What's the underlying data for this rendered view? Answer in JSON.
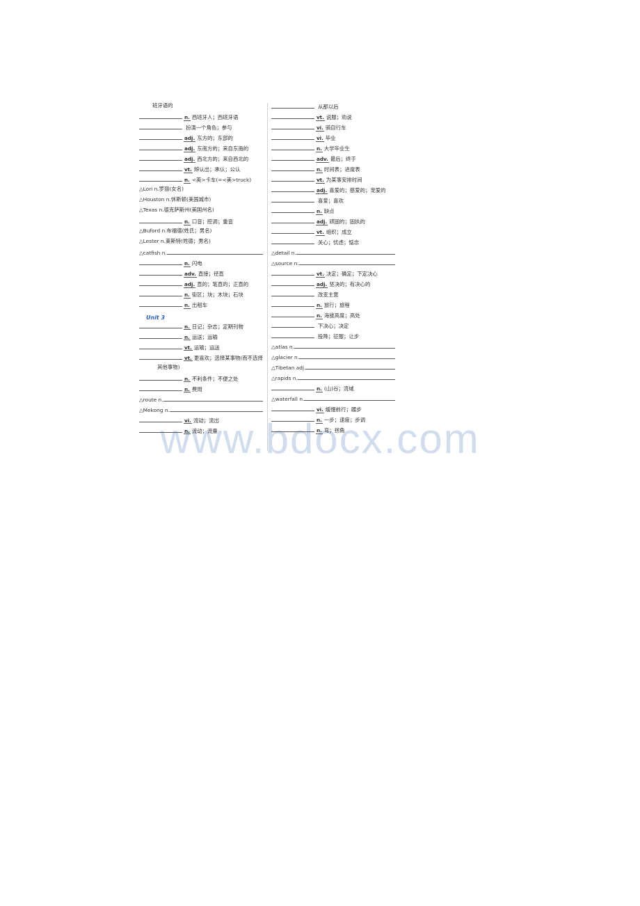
{
  "document": {
    "watermark": "www.bdocx.com",
    "accent_color": "#2f5fb0",
    "text_color": "#2f2f2f",
    "rule_color": "#555555"
  },
  "left_column": {
    "entries": [
      {
        "lead": "",
        "rule": "none",
        "pos": "",
        "cn": "班牙语的",
        "indent": "plain"
      },
      {
        "lead": "",
        "rule": "fixed",
        "pos": "n.",
        "cn": "西班牙人；西班牙语"
      },
      {
        "lead": "",
        "rule": "fixed",
        "pos": "",
        "cn": "扮演一个角色；参与"
      },
      {
        "lead": "",
        "rule": "fixed",
        "pos": "adj.",
        "cn": "东方的；东部的"
      },
      {
        "lead": "",
        "rule": "fixed",
        "pos": "adj.",
        "cn": "东南方的；来自东南的"
      },
      {
        "lead": "",
        "rule": "fixed",
        "pos": "adj.",
        "cn": "西北方的；来自西北的"
      },
      {
        "lead": "",
        "rule": "fixed",
        "pos": "vt.",
        "cn": "辨认出；承认；公认"
      },
      {
        "lead": "",
        "rule": "fixed",
        "pos": "n.",
        "cn": "<英>卡车(=<美>truck)"
      },
      {
        "lead": "△Lori n.罗丽(女名)",
        "rule": "none",
        "pos": "",
        "cn": "",
        "indent": "tri"
      },
      {
        "lead": "△Houston n.休斯顿(美国城市)",
        "rule": "none",
        "pos": "",
        "cn": "",
        "indent": "tri"
      },
      {
        "lead": "△Texas n.德克萨斯州(美国州名)",
        "rule": "none",
        "pos": "",
        "cn": "",
        "indent": "tri"
      },
      {
        "lead": "",
        "rule": "fixed",
        "pos": "n.",
        "cn": "口音；腔调；重音"
      },
      {
        "lead": "△Buford n.布福德(姓氏；男名)",
        "rule": "none",
        "pos": "",
        "cn": "",
        "indent": "tri"
      },
      {
        "lead": "△Lester n.莱斯特(姓德；男名)",
        "rule": "none",
        "pos": "",
        "cn": "",
        "indent": "tri"
      },
      {
        "lead": "△catfish n.",
        "rule": "trail",
        "pos": "",
        "cn": "",
        "indent": "tri"
      },
      {
        "lead": "",
        "rule": "fixed",
        "pos": "n.",
        "cn": "闪电"
      },
      {
        "lead": "",
        "rule": "fixed",
        "pos": "adv.",
        "cn": "直接；径直"
      },
      {
        "lead": "",
        "rule": "fixed",
        "pos": "adj.",
        "cn": "直的；笔直的；正直的"
      },
      {
        "lead": "",
        "rule": "fixed",
        "pos": "n.",
        "cn": "街区；块；木块；石块"
      },
      {
        "lead": "",
        "rule": "fixed",
        "pos": "n.",
        "cn": "出租车"
      }
    ],
    "unit_heading": "Unit 3",
    "entries_after_unit": [
      {
        "lead": "",
        "rule": "fixed",
        "pos": "n.",
        "cn": "日记；杂志；定期刊物"
      },
      {
        "lead": "",
        "rule": "fixed",
        "pos": "n.",
        "cn": "运送；运输"
      },
      {
        "lead": "",
        "rule": "fixed",
        "pos": "vt.",
        "cn": "运输；运送"
      },
      {
        "lead": "",
        "rule": "fixed",
        "pos": "vt.",
        "cn": "更喜欢；选择某事物(而不选择"
      },
      {
        "lead": "其他事物)",
        "rule": "none",
        "pos": "",
        "cn": "",
        "indent": "cont"
      },
      {
        "lead": "",
        "rule": "fixed",
        "pos": "n.",
        "cn": "不利条件；不便之处"
      },
      {
        "lead": "",
        "rule": "fixed",
        "pos": "n.",
        "cn": "费用"
      },
      {
        "lead": "△route n.",
        "rule": "trail",
        "pos": "",
        "cn": "",
        "indent": "tri"
      },
      {
        "lead": "△Mekong n.",
        "rule": "trail",
        "pos": "",
        "cn": "",
        "indent": "tri"
      },
      {
        "lead": "",
        "rule": "fixed",
        "pos": "vi.",
        "cn": "流动；流出"
      },
      {
        "lead": "",
        "rule": "fixed",
        "pos": "n.",
        "cn": "流动；流量"
      }
    ]
  },
  "right_column": {
    "entries": [
      {
        "lead": "",
        "rule": "fixed",
        "pos": "",
        "cn": "从那以后"
      },
      {
        "lead": "",
        "rule": "fixed",
        "pos": "vt.",
        "cn": "说服；劝说"
      },
      {
        "lead": "",
        "rule": "fixed",
        "pos": "vi.",
        "cn": "骑自行车"
      },
      {
        "lead": "",
        "rule": "fixed",
        "pos": "vi.",
        "cn": "毕业"
      },
      {
        "lead": "",
        "rule": "fixed",
        "pos": "n.",
        "cn": "大学毕业生"
      },
      {
        "lead": "",
        "rule": "fixed",
        "pos": "adv.",
        "cn": "最后；终于"
      },
      {
        "lead": "",
        "rule": "fixed",
        "pos": "n.",
        "cn": "时间表；进度表"
      },
      {
        "lead": "",
        "rule": "fixed",
        "pos": "vt.",
        "cn": "为某事安排时间"
      },
      {
        "lead": "",
        "rule": "fixed",
        "pos": "adj.",
        "cn": "喜爱的；慈爱的；宠爱的"
      },
      {
        "lead": "",
        "rule": "fixed",
        "pos": "",
        "cn": "喜爱；喜欢"
      },
      {
        "lead": "",
        "rule": "fixed",
        "pos": "n.",
        "cn": "缺点"
      },
      {
        "lead": "",
        "rule": "fixed",
        "pos": "adj.",
        "cn": "顽固的；固执的"
      },
      {
        "lead": "",
        "rule": "fixed",
        "pos": "vt.",
        "cn": "组织；成立"
      },
      {
        "lead": "",
        "rule": "fixed",
        "pos": "",
        "cn": "关心；忧虑；惦念"
      },
      {
        "lead": "△detail n.",
        "rule": "trail",
        "pos": "",
        "cn": "",
        "indent": "tri"
      },
      {
        "lead": "△source n.",
        "rule": "trail",
        "pos": "",
        "cn": "",
        "indent": "tri"
      },
      {
        "lead": "",
        "rule": "fixed",
        "pos": "vt.",
        "cn": "决定；确定；下定决心"
      },
      {
        "lead": "",
        "rule": "fixed",
        "pos": "adj.",
        "cn": "坚决的；有决心的"
      },
      {
        "lead": "",
        "rule": "fixed",
        "pos": "",
        "cn": "改变主意"
      },
      {
        "lead": "",
        "rule": "fixed",
        "pos": "n.",
        "cn": "旅行；旅程"
      },
      {
        "lead": "",
        "rule": "fixed",
        "pos": "n.",
        "cn": "海拔高度；高处"
      },
      {
        "lead": "",
        "rule": "fixed",
        "pos": "",
        "cn": "下决心；决定"
      },
      {
        "lead": "",
        "rule": "fixed",
        "pos": "",
        "cn": "投降；征服；让步"
      },
      {
        "lead": "△atlas n.",
        "rule": "trail",
        "pos": "",
        "cn": "",
        "indent": "tri"
      },
      {
        "lead": "△glacier n.",
        "rule": "trail",
        "pos": "",
        "cn": "",
        "indent": "tri"
      },
      {
        "lead": "△Tibetan adj.",
        "rule": "trail",
        "pos": "",
        "cn": "",
        "indent": "tri"
      },
      {
        "lead": "△rapids n.",
        "rule": "trail",
        "pos": "",
        "cn": "",
        "indent": "tri"
      },
      {
        "lead": "",
        "rule": "fixed",
        "pos": "n.",
        "cn": "(山)谷；流域"
      },
      {
        "lead": "△waterfall n.",
        "rule": "trail",
        "pos": "",
        "cn": "",
        "indent": "tri"
      },
      {
        "lead": "",
        "rule": "fixed",
        "pos": "vi.",
        "cn": "缓慢前行；踱步"
      },
      {
        "lead": "",
        "rule": "fixed",
        "pos": "n.",
        "cn": "一步；速度；步调"
      },
      {
        "lead": "",
        "rule": "fixed",
        "pos": "n.",
        "cn": "弯；拐角"
      }
    ]
  }
}
